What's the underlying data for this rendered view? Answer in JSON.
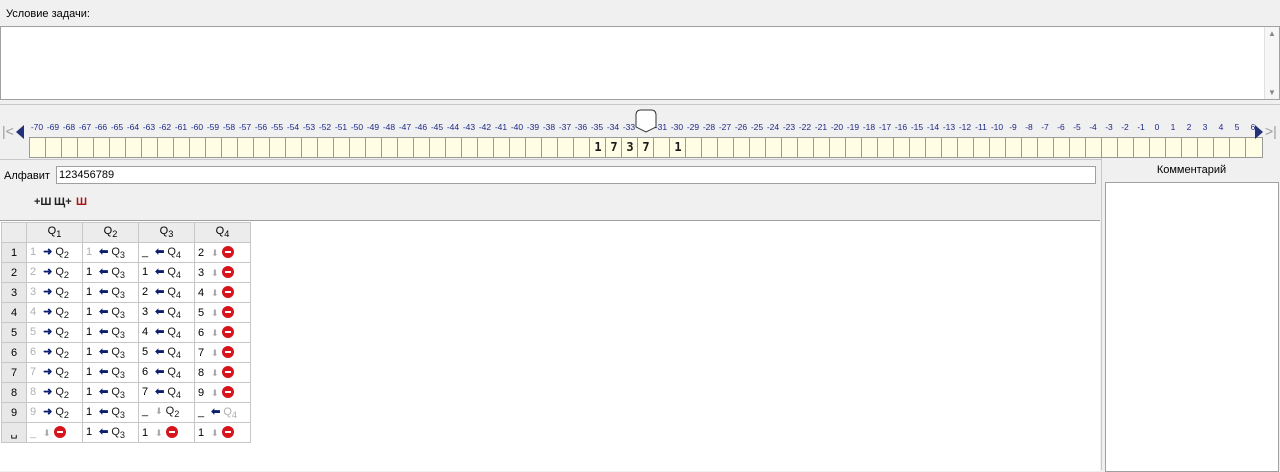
{
  "task": {
    "label": "Условие задачи:",
    "value": ""
  },
  "tape": {
    "indices": [
      "-70",
      "-69",
      "-68",
      "-67",
      "-66",
      "-65",
      "-64",
      "-63",
      "-62",
      "-61",
      "-60",
      "-59",
      "-58",
      "-57",
      "-56",
      "-55",
      "-54",
      "-53",
      "-52",
      "-51",
      "-50",
      "-49",
      "-48",
      "-47",
      "-46",
      "-45",
      "-44",
      "-43",
      "-42",
      "-41",
      "-40",
      "-39",
      "-38",
      "-37",
      "-36",
      "-35",
      "-34",
      "-33",
      "-32",
      "-31",
      "-30",
      "-29",
      "-28",
      "-27",
      "-26",
      "-25",
      "-24",
      "-23",
      "-22",
      "-21",
      "-20",
      "-19",
      "-18",
      "-17",
      "-16",
      "-15",
      "-14",
      "-13",
      "-12",
      "-11",
      "-10",
      "-9",
      "-8",
      "-7",
      "-6",
      "-5",
      "-4",
      "-3",
      "-2",
      "-1",
      "0",
      "1",
      "2",
      "3",
      "4",
      "5",
      "6"
    ],
    "cells": [
      "",
      "",
      "",
      "",
      "",
      "",
      "",
      "",
      "",
      "",
      "",
      "",
      "",
      "",
      "",
      "",
      "",
      "",
      "",
      "",
      "",
      "",
      "",
      "",
      "",
      "",
      "",
      "",
      "",
      "",
      "",
      "",
      "",
      "",
      "",
      "1",
      "7",
      "3",
      "7",
      "",
      "1",
      "",
      "",
      "",
      "",
      "",
      "",
      "",
      "",
      "",
      "",
      "",
      "",
      "",
      "",
      "",
      "",
      "",
      "",
      "",
      "",
      "",
      "",
      "",
      "",
      "",
      "",
      "",
      "",
      "",
      "",
      "",
      "",
      "",
      "",
      "",
      "",
      "",
      "",
      ""
    ],
    "head_index": "-32"
  },
  "alphabet": {
    "label": "Алфавит",
    "value": "123456789"
  },
  "toolbar": {
    "icons": [
      "add-column-icon",
      "insert-column-icon",
      "delete-column-icon"
    ]
  },
  "table": {
    "columns": [
      {
        "q": "Q",
        "sub": "1"
      },
      {
        "q": "Q",
        "sub": "2"
      },
      {
        "q": "Q",
        "sub": "3"
      },
      {
        "q": "Q",
        "sub": "4"
      }
    ],
    "rows": [
      {
        "sym": "1",
        "cells": [
          {
            "w": "1",
            "wg": true,
            "a": "R",
            "q": "2"
          },
          {
            "w": "1",
            "wg": true,
            "a": "L",
            "q": "3"
          },
          {
            "w": "_",
            "wg": false,
            "a": "L",
            "q": "4"
          },
          {
            "w": "2",
            "wg": false,
            "a": "D",
            "stop": true
          }
        ]
      },
      {
        "sym": "2",
        "cells": [
          {
            "w": "2",
            "wg": true,
            "a": "R",
            "q": "2"
          },
          {
            "w": "1",
            "wg": false,
            "a": "L",
            "q": "3"
          },
          {
            "w": "1",
            "wg": false,
            "a": "L",
            "q": "4"
          },
          {
            "w": "3",
            "wg": false,
            "a": "D",
            "stop": true
          }
        ]
      },
      {
        "sym": "3",
        "cells": [
          {
            "w": "3",
            "wg": true,
            "a": "R",
            "q": "2"
          },
          {
            "w": "1",
            "wg": false,
            "a": "L",
            "q": "3"
          },
          {
            "w": "2",
            "wg": false,
            "a": "L",
            "q": "4"
          },
          {
            "w": "4",
            "wg": false,
            "a": "D",
            "stop": true
          }
        ]
      },
      {
        "sym": "4",
        "cells": [
          {
            "w": "4",
            "wg": true,
            "a": "R",
            "q": "2"
          },
          {
            "w": "1",
            "wg": false,
            "a": "L",
            "q": "3"
          },
          {
            "w": "3",
            "wg": false,
            "a": "L",
            "q": "4"
          },
          {
            "w": "5",
            "wg": false,
            "a": "D",
            "stop": true
          }
        ]
      },
      {
        "sym": "5",
        "cells": [
          {
            "w": "5",
            "wg": true,
            "a": "R",
            "q": "2"
          },
          {
            "w": "1",
            "wg": false,
            "a": "L",
            "q": "3"
          },
          {
            "w": "4",
            "wg": false,
            "a": "L",
            "q": "4"
          },
          {
            "w": "6",
            "wg": false,
            "a": "D",
            "stop": true
          }
        ]
      },
      {
        "sym": "6",
        "cells": [
          {
            "w": "6",
            "wg": true,
            "a": "R",
            "q": "2"
          },
          {
            "w": "1",
            "wg": false,
            "a": "L",
            "q": "3"
          },
          {
            "w": "5",
            "wg": false,
            "a": "L",
            "q": "4"
          },
          {
            "w": "7",
            "wg": false,
            "a": "D",
            "stop": true
          }
        ]
      },
      {
        "sym": "7",
        "cells": [
          {
            "w": "7",
            "wg": true,
            "a": "R",
            "q": "2"
          },
          {
            "w": "1",
            "wg": false,
            "a": "L",
            "q": "3"
          },
          {
            "w": "6",
            "wg": false,
            "a": "L",
            "q": "4"
          },
          {
            "w": "8",
            "wg": false,
            "a": "D",
            "stop": true
          }
        ]
      },
      {
        "sym": "8",
        "cells": [
          {
            "w": "8",
            "wg": true,
            "a": "R",
            "q": "2"
          },
          {
            "w": "1",
            "wg": false,
            "a": "L",
            "q": "3"
          },
          {
            "w": "7",
            "wg": false,
            "a": "L",
            "q": "4"
          },
          {
            "w": "9",
            "wg": false,
            "a": "D",
            "stop": true
          }
        ]
      },
      {
        "sym": "9",
        "cells": [
          {
            "w": "9",
            "wg": true,
            "a": "R",
            "q": "2"
          },
          {
            "w": "1",
            "wg": false,
            "a": "L",
            "q": "3"
          },
          {
            "w": "_",
            "wg": false,
            "a": "D",
            "q": "2"
          },
          {
            "w": "_",
            "wg": false,
            "a": "L",
            "q": "4",
            "qg": true
          }
        ]
      },
      {
        "sym": "␣",
        "cells": [
          {
            "w": "_",
            "wg": true,
            "a": "D",
            "stop": true
          },
          {
            "w": "1",
            "wg": false,
            "a": "L",
            "q": "3"
          },
          {
            "w": "1",
            "wg": false,
            "a": "D",
            "stop": true
          },
          {
            "w": "1",
            "wg": false,
            "a": "D",
            "stop": true
          }
        ]
      }
    ]
  },
  "comment": {
    "label": "Комментарий",
    "value": ""
  }
}
